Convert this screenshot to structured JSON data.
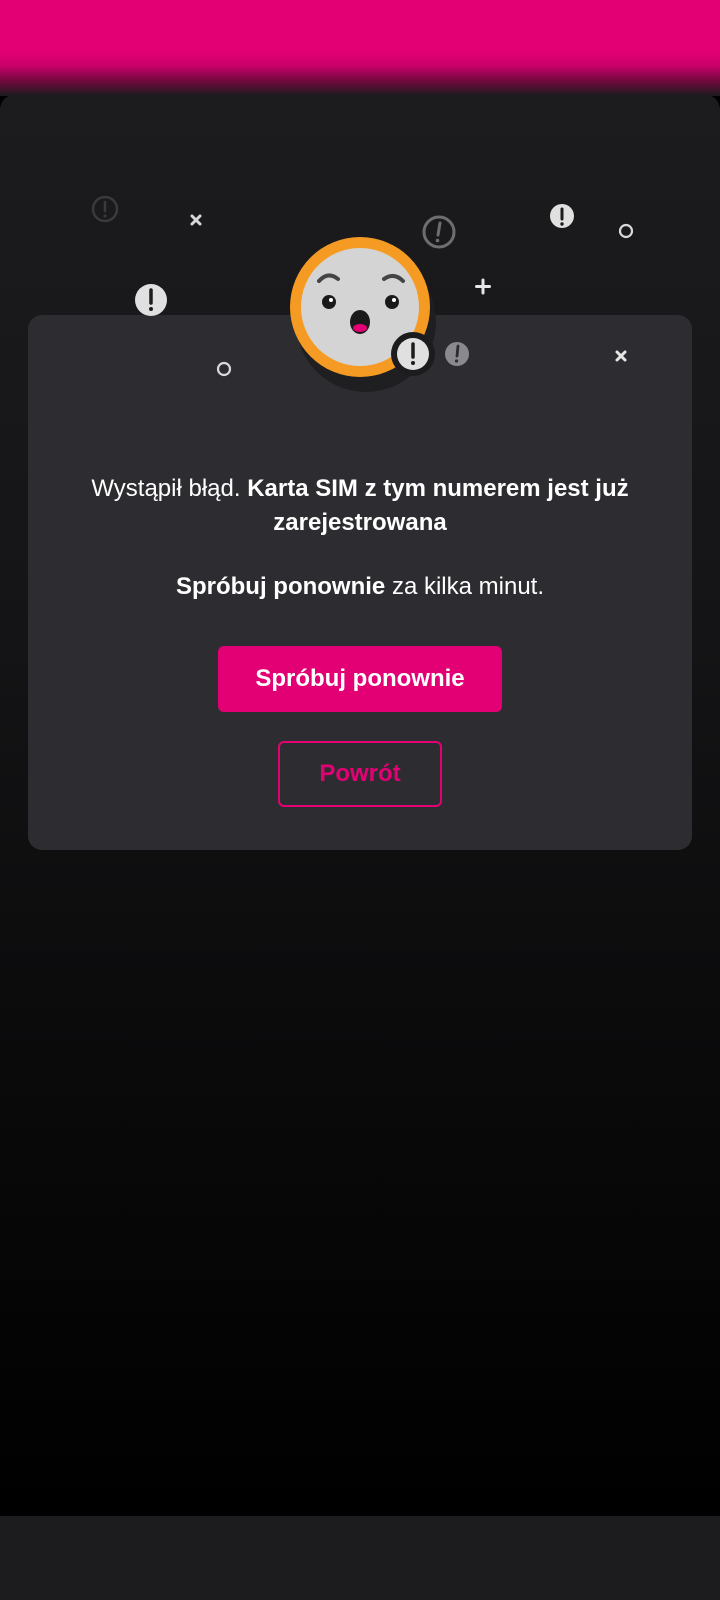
{
  "error": {
    "prefix": "Wystąpił błąd.",
    "emphasis": "Karta SIM z tym numerem jest już zarejestrowana"
  },
  "retry_hint": {
    "emphasis": "Spróbuj ponownie",
    "suffix": "za kilka minut."
  },
  "actions": {
    "retry_label": "Spróbuj ponownie",
    "back_label": "Powrót"
  },
  "colors": {
    "brand": "#e20074",
    "face_ring": "#f59b23",
    "card": "#2d2d31"
  },
  "icons": [
    "surprised-face-icon",
    "exclamation-icon",
    "close-icon",
    "plus-icon",
    "circle-icon"
  ]
}
